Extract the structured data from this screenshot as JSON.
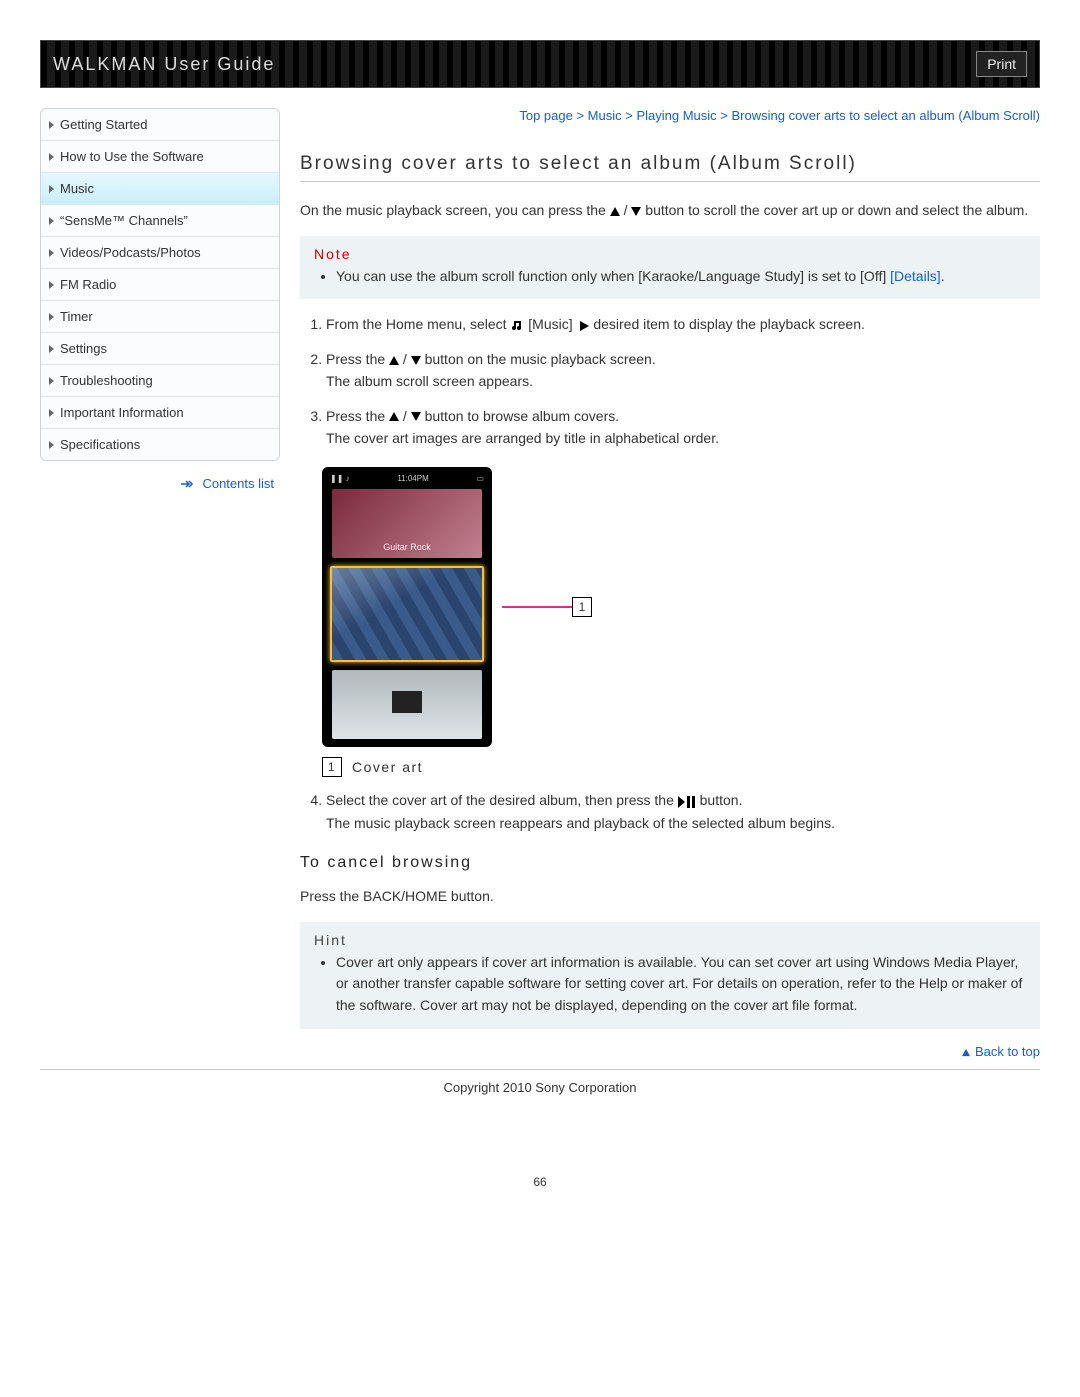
{
  "header": {
    "title": "WALKMAN User Guide",
    "print_label": "Print"
  },
  "sidebar": {
    "items": [
      {
        "label": "Getting Started",
        "active": false
      },
      {
        "label": "How to Use the Software",
        "active": false
      },
      {
        "label": "Music",
        "active": true
      },
      {
        "label": "“SensMe™ Channels”",
        "active": false
      },
      {
        "label": "Videos/Podcasts/Photos",
        "active": false
      },
      {
        "label": "FM Radio",
        "active": false
      },
      {
        "label": "Timer",
        "active": false
      },
      {
        "label": "Settings",
        "active": false
      },
      {
        "label": "Troubleshooting",
        "active": false
      },
      {
        "label": "Important Information",
        "active": false
      },
      {
        "label": "Specifications",
        "active": false
      }
    ],
    "contents_list_label": "Contents list"
  },
  "breadcrumb": {
    "top": "Top page",
    "sep": " > ",
    "l1": "Music",
    "l2": "Playing Music",
    "l3": "Browsing cover arts to select an album (Album Scroll)"
  },
  "page": {
    "heading": "Browsing cover arts to select an album (Album Scroll)",
    "intro_a": "On the music playback screen, you can press the ",
    "intro_slash": " / ",
    "intro_b": " button to scroll the cover art up or down and select the album.",
    "note_title": "Note",
    "note_text_a": "You can use the album scroll function only when [Karaoke/Language Study] is set to [Off] ",
    "note_details": "[Details]",
    "note_text_b": ".",
    "step1_a": "From the Home menu, select ",
    "step1_music": "[Music]",
    "step1_b": "   desired item to display the playback screen.",
    "step2_a": "Press the ",
    "step2_slash": " / ",
    "step2_b": " button on the music playback screen.",
    "step2_c": "The album scroll screen appears.",
    "step3_a": "Press the ",
    "step3_slash": " / ",
    "step3_b": " button to browse album covers.",
    "step3_c": "The cover art images are arranged by title in alphabetical order.",
    "device_time": "11:04PM",
    "callout_num": "1",
    "cover_art_caption": "Cover art",
    "step4_a": "Select the cover art of the desired album, then press the ",
    "step4_b": " button.",
    "step4_c": "The music playback screen reappears and playback of the selected album begins.",
    "cancel_heading": "To cancel browsing",
    "cancel_text": "Press the BACK/HOME button.",
    "hint_title": "Hint",
    "hint_text": "Cover art only appears if cover art information is available. You can set cover art using Windows Media Player, or another transfer capable software for setting cover art. For details on operation, refer to the Help or maker of the software. Cover art may not be displayed, depending on the cover art file format.",
    "back_to_top": "Back to top",
    "copyright": "Copyright 2010 Sony Corporation",
    "page_number": "66"
  }
}
